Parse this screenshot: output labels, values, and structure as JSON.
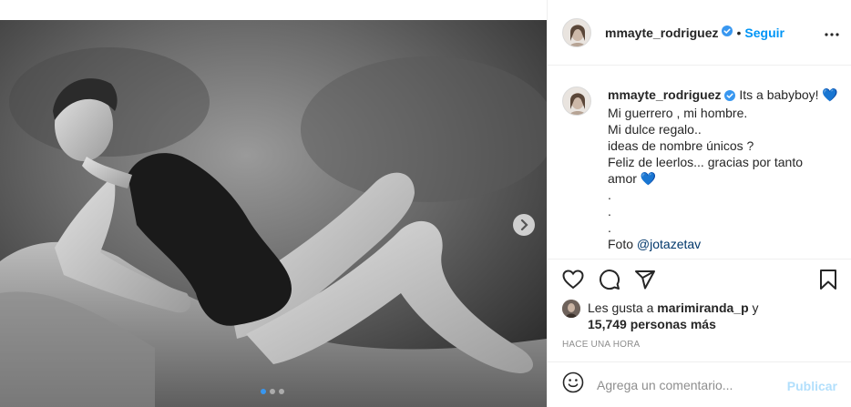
{
  "post": {
    "image_alt": "Black and white maternity photo",
    "carousel": {
      "total_slides": 3,
      "active_slide": 1
    }
  },
  "header": {
    "username": "mmayte_rodriguez",
    "separator": "•",
    "follow_label": "Seguir"
  },
  "caption": {
    "username": "mmayte_rodriguez",
    "lines": [
      "Its a babyboy! 💙",
      "Mi guerrero , mi hombre.",
      "Mi dulce regalo..",
      "ideas de nombre únicos ?",
      "Feliz de leerlos... gracias por tanto",
      "amor 💙",
      ".",
      ".",
      "."
    ],
    "photo_credit_prefix": "Foto ",
    "photo_credit_mention": "@jotazetav"
  },
  "likes": {
    "prefix": "Les gusta a ",
    "user": "marimiranda_p",
    "suffix": " y",
    "count_text": "15,749 personas más"
  },
  "timestamp": "HACE UNA HORA",
  "comment": {
    "placeholder": "Agrega un comentario...",
    "publish_label": "Publicar"
  },
  "colors": {
    "accent": "#0095f6",
    "verified": "#3897f0",
    "publish_disabled": "#b2dffc",
    "muted": "#8e8e8e"
  }
}
